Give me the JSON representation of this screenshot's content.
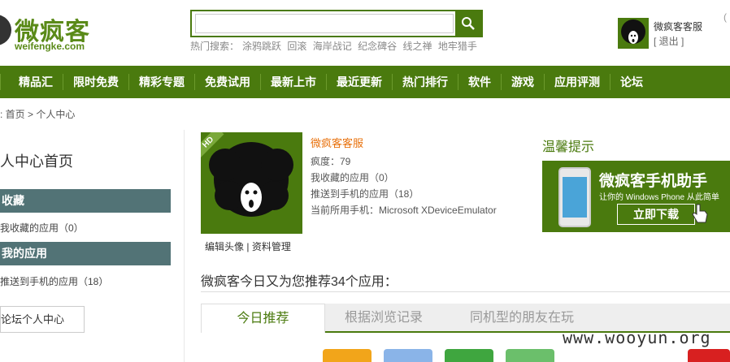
{
  "logo": {
    "cn": "微疯客",
    "en": "weifengke.com"
  },
  "search": {
    "value": "",
    "placeholder": "",
    "hot_label": "热门搜索：",
    "hot_terms": [
      "涂鸦跳跃",
      "回滚",
      "海岸战记",
      "纪念碑谷",
      "线之禅",
      "地牢猎手"
    ]
  },
  "user": {
    "name": "微疯客客服",
    "logout": "[ 退出 ]"
  },
  "top_edge": "(",
  "nav": [
    "精品汇",
    "限时免费",
    "精彩专题",
    "免费试用",
    "最新上市",
    "最近更新",
    "热门排行",
    "软件",
    "游戏",
    "应用评测",
    "论坛"
  ],
  "breadcrumb": ": 首页  >  个人中心",
  "sidebar": {
    "title": "人中心首页",
    "favorites": {
      "heading": "收藏",
      "link": "我收藏的应用（0）"
    },
    "apps": {
      "heading": "我的应用",
      "link": "推送到手机的应用（18）"
    },
    "forum_button": "论坛个人中心"
  },
  "avatar": {
    "badge": "HD",
    "edit": "编辑头像",
    "sep": "|",
    "manage": "资料管理"
  },
  "profile": {
    "name": "微疯客客服",
    "level": "疯度：79",
    "favorites": "我收藏的应用（0）",
    "pushed": "推送到手机的应用（18）",
    "device": "当前所用手机：Microsoft XDeviceEmulator"
  },
  "tips": {
    "title": "温馨提示",
    "banner_title": "微疯客手机助手",
    "banner_sub": "让你的 Windows Phone 从此简单",
    "banner_button": "立即下载"
  },
  "recommend": {
    "title": "微疯客今日又为您推荐34个应用："
  },
  "tabs": [
    "今日推荐",
    "根据浏览记录",
    "同机型的朋友在玩"
  ],
  "watermark": "www.wooyun.org",
  "colors": {
    "brand": "#4a7a0e",
    "sidebar_head": "#527376",
    "accent": "#e8700a"
  },
  "icons": [
    "search-icon",
    "afro-avatar-icon",
    "hand-cursor-icon",
    "phone-icon"
  ]
}
